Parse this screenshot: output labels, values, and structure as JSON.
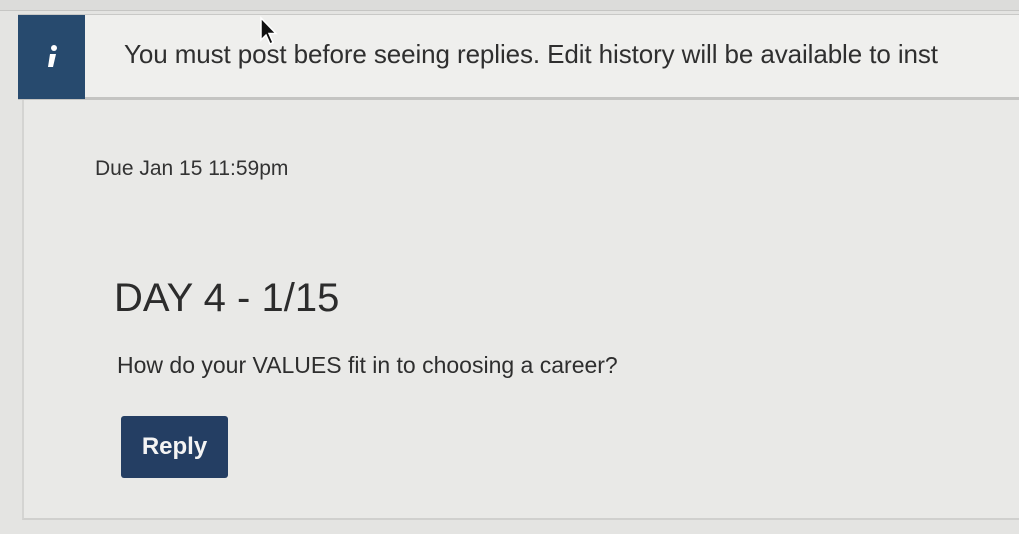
{
  "notice": {
    "icon": "info-icon",
    "text": "You must post before seeing replies. Edit history will be available to inst"
  },
  "topic": {
    "due": "Due Jan 15 11:59pm",
    "title": "DAY 4 - 1/15",
    "question": "How do your VALUES fit in to choosing a career?",
    "reply_label": "Reply"
  },
  "colors": {
    "notice_icon_bg": "#274a6e",
    "reply_button_bg": "#243e63"
  }
}
